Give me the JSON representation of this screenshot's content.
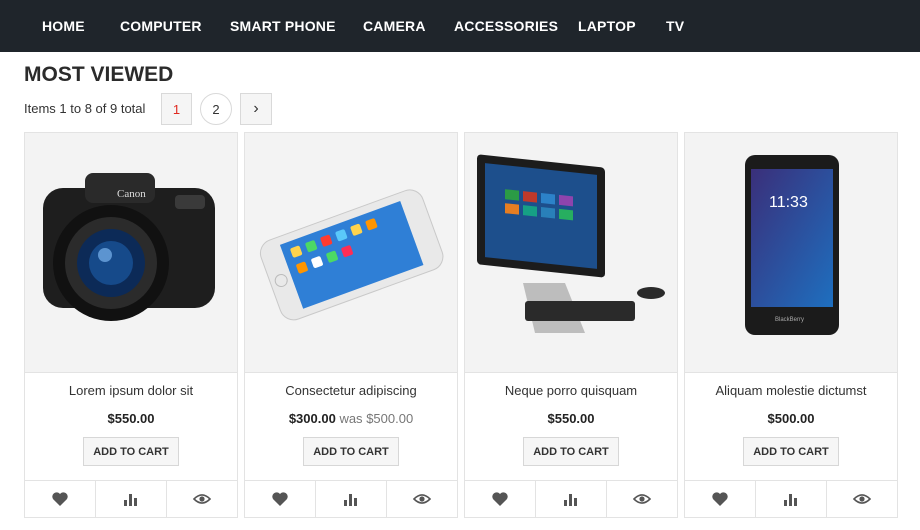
{
  "nav": {
    "items": [
      {
        "label": "HOME"
      },
      {
        "label": "COMPUTER"
      },
      {
        "label": "SMART PHONE"
      },
      {
        "label": "CAMERA"
      },
      {
        "label": "ACCESSORIES"
      },
      {
        "label": "LAPTOP"
      },
      {
        "label": "TV"
      }
    ]
  },
  "section": {
    "title": "MOST VIEWED",
    "count_text": "Items 1 to 8 of 9 total"
  },
  "pager": {
    "current": "1",
    "page2": "2",
    "next": "›"
  },
  "products": [
    {
      "name": "Lorem ipsum dolor sit",
      "price": "$550.00",
      "old_price_prefix": "",
      "old_price": "",
      "cart": "ADD TO CART"
    },
    {
      "name": "Consectetur adipiscing",
      "price": "$300.00",
      "old_price_prefix": "was",
      "old_price": "$500.00",
      "cart": "ADD TO CART"
    },
    {
      "name": "Neque porro quisquam",
      "price": "$550.00",
      "old_price_prefix": "",
      "old_price": "",
      "cart": "ADD TO CART"
    },
    {
      "name": "Aliquam molestie dictumst",
      "price": "$500.00",
      "old_price_prefix": "",
      "old_price": "",
      "cart": "ADD TO CART"
    }
  ],
  "icons": {
    "wishlist": "heart-icon",
    "compare": "bar-chart-icon",
    "quickview": "eye-icon",
    "icon_color": "#555555"
  },
  "colors": {
    "nav_bg": "#1f252b",
    "accent": "#e0291f"
  }
}
